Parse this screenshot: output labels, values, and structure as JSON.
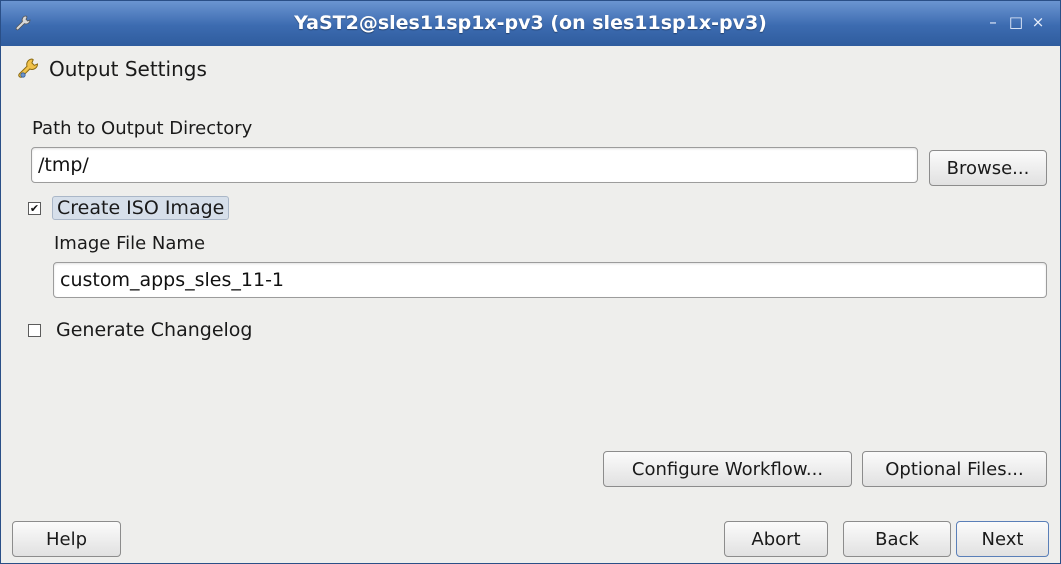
{
  "window": {
    "title": "YaST2@sles11sp1x-pv3 (on sles11sp1x-pv3)",
    "controls": {
      "minimize": "–",
      "maximize": "□",
      "close": "×"
    },
    "accent_color": "#3c6bb0"
  },
  "heading": {
    "text": "Output Settings",
    "icon": "wrench-icon"
  },
  "output_dir": {
    "label": "Path to Output Directory",
    "mnemonic": "a",
    "value": "/tmp/",
    "browse_label": "Browse..."
  },
  "iso": {
    "label": "Create ISO Image",
    "checked": true,
    "check_glyph": "✔",
    "image_label": "Image File Name",
    "image_value": "custom_apps_sles_11-1"
  },
  "changelog": {
    "label": "Generate Changelog",
    "checked": false
  },
  "buttons": {
    "configure": "Configure Workflow...",
    "optional": "Optional Files...",
    "help": "Help",
    "abort": "Abort",
    "back": "Back",
    "next": "Next"
  }
}
